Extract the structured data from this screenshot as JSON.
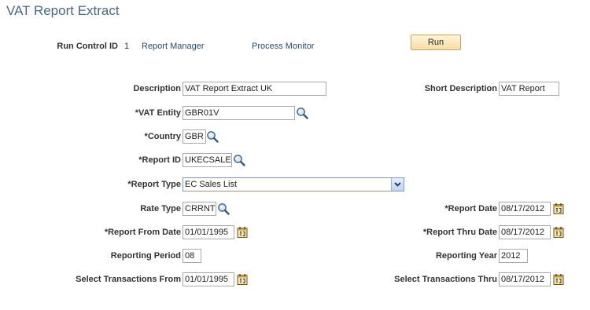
{
  "page": {
    "title": "VAT Report Extract"
  },
  "header": {
    "run_control_label": "Run Control ID",
    "run_control_value": "1",
    "report_manager_link": "Report Manager",
    "process_monitor_link": "Process Monitor",
    "run_button": "Run"
  },
  "form": {
    "description": {
      "label": "Description",
      "value": "VAT Report Extract UK"
    },
    "short_description": {
      "label": "Short Description",
      "value": "VAT Report"
    },
    "vat_entity": {
      "label": "*VAT Entity",
      "value": "GBR01V"
    },
    "country": {
      "label": "*Country",
      "value": "GBR"
    },
    "report_id": {
      "label": "*Report ID",
      "value": "UKECSALE"
    },
    "report_type": {
      "label": "*Report Type",
      "value": "EC Sales List"
    },
    "rate_type": {
      "label": "Rate Type",
      "value": "CRRNT"
    },
    "report_date": {
      "label": "*Report Date",
      "value": "08/17/2012"
    },
    "report_from_date": {
      "label": "*Report From Date",
      "value": "01/01/1995"
    },
    "report_thru_date": {
      "label": "*Report Thru Date",
      "value": "08/17/2012"
    },
    "reporting_period": {
      "label": "Reporting Period",
      "value": "08"
    },
    "reporting_year": {
      "label": "Reporting Year",
      "value": "2012"
    },
    "select_trans_from": {
      "label": "Select Transactions From",
      "value": "01/01/1995"
    },
    "select_trans_thru": {
      "label": "Select Transactions Thru",
      "value": "08/17/2012"
    }
  },
  "icons": {
    "lookup": "magnifier-icon",
    "calendar": "calendar-icon",
    "dropdown": "chevron-down-icon"
  }
}
